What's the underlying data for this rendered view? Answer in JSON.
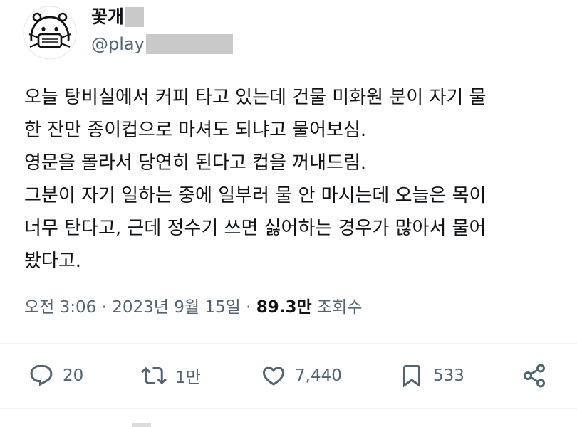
{
  "header": {
    "display_name": "꽃개",
    "handle": "@play"
  },
  "body": {
    "lines": [
      "오늘 탕비실에서 커피 타고 있는데 건물 미화원 분이 자기 물",
      "한 잔만 종이컵으로 마셔도 되냐고 물어보심.",
      "영문을 몰라서 당연히 된다고 컵을 꺼내드림.",
      "그분이 자기 일하는 중에 일부러 물 안 마시는데 오늘은 목이",
      "너무 탄다고, 근데 정수기 쓰면 싫어하는 경우가 많아서 물어",
      "봤다고."
    ]
  },
  "meta": {
    "time": "오전 3:06",
    "separator": " · ",
    "date": "2023년 9월 15일",
    "views_count": "89.3만",
    "views_label": " 조회수"
  },
  "actions": {
    "reply_count": "20",
    "retweet_count": "1만",
    "like_count": "7,440",
    "bookmark_count": "533"
  },
  "icons": {
    "reply": "speech-bubble-icon",
    "retweet": "retweet-arrows-icon",
    "like": "heart-icon",
    "bookmark": "bookmark-icon",
    "share": "share-icon"
  },
  "colors": {
    "text": "#0f1419",
    "secondary": "#536471",
    "divider": "#eff3f4",
    "redaction": "#c9c9c9"
  }
}
